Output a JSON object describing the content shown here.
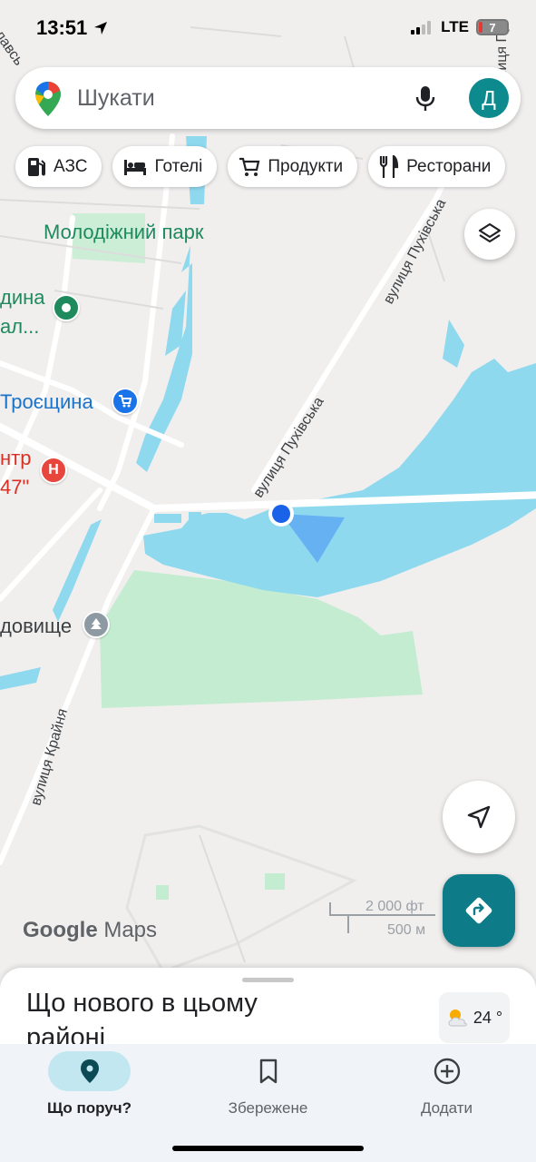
{
  "status_bar": {
    "time": "13:51",
    "network": "LTE",
    "battery": "7"
  },
  "search": {
    "placeholder": "Шукати",
    "avatar_letter": "Д"
  },
  "chips": [
    {
      "label": "АЗС",
      "icon": "gas-station-icon"
    },
    {
      "label": "Готелі",
      "icon": "bed-icon"
    },
    {
      "label": "Продукти",
      "icon": "cart-icon"
    },
    {
      "label": "Ресторани",
      "icon": "fork-knife-icon"
    }
  ],
  "map": {
    "park_label": "Молодіжний парк",
    "label_clipped_left_1": "дина",
    "label_clipped_left_2": "ал...",
    "place_troieshchyna": "Троєщина",
    "hospital_line1": "нтр",
    "hospital_line2": "47\"",
    "hospital_marker": "H",
    "label_dovyshche": "довище",
    "street_pukhivska": "вулиця Пухівська",
    "street_pukhivska_top": "вулиця Пухівська",
    "street_kraina": "вулиця Крайня",
    "street_top_left": "славсь",
    "street_top_right": "лиця Пу",
    "colors": {
      "water": "#8fd9ef",
      "park": "#c3ecd0",
      "road": "#ffffff",
      "background": "#f1efee",
      "location_dot": "#1a62e8"
    }
  },
  "watermark": {
    "google": "Google",
    "maps": "Maps"
  },
  "scale": {
    "imperial": "2 000 фт",
    "metric": "500 м"
  },
  "sheet": {
    "title": "Що нового в цьому районі",
    "weather": "24 °"
  },
  "bottom_nav": [
    {
      "label": "Що поруч?",
      "icon": "location-pin-icon",
      "active": true
    },
    {
      "label": "Збережене",
      "icon": "bookmark-icon",
      "active": false
    },
    {
      "label": "Додати",
      "icon": "add-circle-icon",
      "active": false
    }
  ],
  "accent_color": "#0d7c88"
}
